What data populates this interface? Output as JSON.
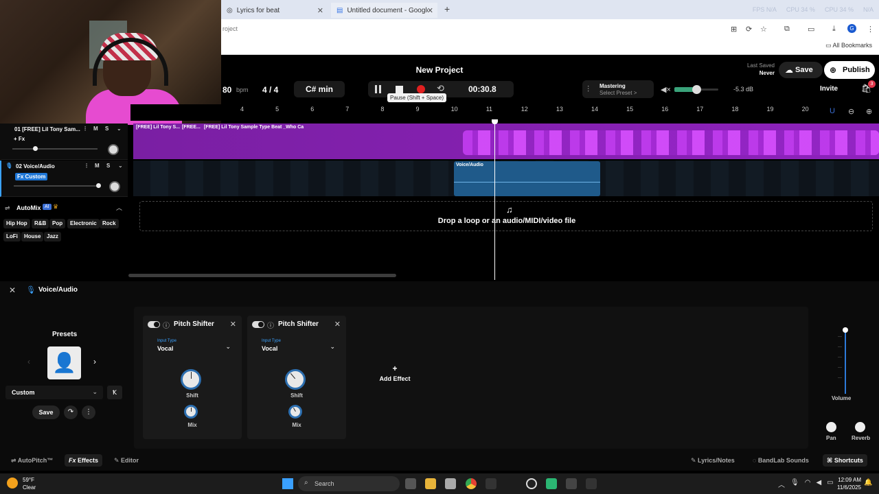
{
  "browser": {
    "tabs": [
      {
        "label": "Lyrics for beat"
      },
      {
        "label": "Untitled document - Google D..."
      }
    ],
    "new_tab": "+",
    "stats": [
      "FPS N/A",
      "CPU 34 %",
      "CPU 34 %",
      "N/A"
    ],
    "address": "roject",
    "all_bookmarks": "All Bookmarks"
  },
  "header": {
    "project_title": "New Project",
    "bpm": "80",
    "bpm_unit": "bpm",
    "time_signature": "4 / 4",
    "key": "C# min",
    "timecode": "00:30.8",
    "pause_tooltip": "Pause (Shift + Space)",
    "mastering_label": "Mastering",
    "mastering_preset": "Select Preset >",
    "volume_db": "-5.3 dB",
    "last_saved_label": "Last Saved",
    "last_saved_value": "Never",
    "save_label": "Save",
    "publish_label": "Publish",
    "invite_label": "Invite",
    "cart_count": "3"
  },
  "ruler": {
    "ticks": [
      "4",
      "5",
      "6",
      "7",
      "8",
      "9",
      "10",
      "11",
      "12",
      "13",
      "14",
      "15",
      "16",
      "17",
      "18",
      "19",
      "20"
    ]
  },
  "tracks": [
    {
      "name": "01 [FREE] Lil Tony Sam...",
      "fx": "+ Fx",
      "mute": "M",
      "solo": "S",
      "volume_level": 0.25
    },
    {
      "name": "02 Voice/Audio",
      "fx": "Fx Custom",
      "mute": "M",
      "solo": "S",
      "volume_level": 1.0
    }
  ],
  "clips": {
    "track1": [
      "[FREE] Lil Tony S...",
      "[FREE...",
      "[FREE] Lil Tony Sample Type Beat _Who Ca"
    ],
    "voice": "Voice/Audio"
  },
  "dropzone": {
    "text": "Drop a loop or an audio/MIDI/video file"
  },
  "automix": {
    "label": "AutoMix",
    "ai_badge": "AI",
    "genres": [
      "Hip Hop",
      "R&B",
      "Pop",
      "Electronic",
      "Rock",
      "LoFi",
      "House",
      "Jazz"
    ]
  },
  "fx_panel": {
    "title": "Voice/Audio",
    "presets_label": "Presets",
    "preset_value": "Custom",
    "save_label": "Save",
    "effects": [
      {
        "name": "Pitch Shifter",
        "input_type_label": "Input Type",
        "input_type": "Vocal",
        "shift_label": "Shift",
        "mix_label": "Mix"
      },
      {
        "name": "Pitch Shifter",
        "input_type_label": "Input Type",
        "input_type": "Vocal",
        "shift_label": "Shift",
        "mix_label": "Mix"
      }
    ],
    "add_effect_label": "Add Effect",
    "volume_label": "Volume",
    "pan_label": "Pan",
    "reverb_label": "Reverb"
  },
  "bottom_bar": {
    "autopitch": "AutoPitch™",
    "effects": "Effects",
    "editor": "Editor",
    "lyrics": "Lyrics/Notes",
    "sounds": "BandLab Sounds",
    "shortcuts": "Shortcuts"
  },
  "taskbar": {
    "temperature": "59°F",
    "condition": "Clear",
    "search_placeholder": "Search",
    "time": "12:09 AM",
    "date": "11/6/2025"
  },
  "colors": {
    "track1": "#8e22bd",
    "voice_clip": "#1f5a8a",
    "accent": "#3ba2ff"
  }
}
